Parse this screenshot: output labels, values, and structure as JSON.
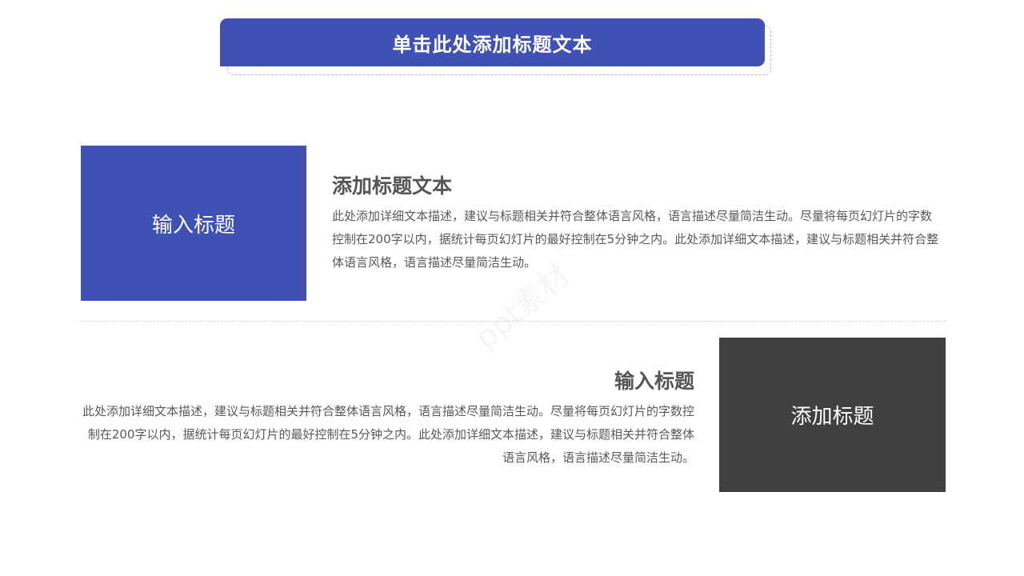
{
  "header": {
    "title": "单击此处添加标题文本"
  },
  "section1": {
    "block_label": "输入标题",
    "heading": "添加标题文本",
    "body": "此处添加详细文本描述，建议与标题相关并符合整体语言风格，语言描述尽量简洁生动。尽量将每页幻灯片的字数控制在200字以内，据统计每页幻灯片的最好控制在5分钟之内。此处添加详细文本描述，建议与标题相关并符合整体语言风格，语言描述尽量简洁生动。"
  },
  "section2": {
    "block_label": "添加标题",
    "heading": "输入标题",
    "body": "此处添加详细文本描述，建议与标题相关并符合整体语言风格，语言描述尽量简洁生动。尽量将每页幻灯片的字数控制在200字以内，据统计每页幻灯片的最好控制在5分钟之内。此处添加详细文本描述，建议与标题相关并符合整体语言风格，语言描述尽量简洁生动。"
  },
  "watermark": {
    "text": "ppt素材"
  },
  "colors": {
    "accent_blue": "#3f51b5",
    "dark_gray": "#404040",
    "text_gray": "#555555"
  }
}
